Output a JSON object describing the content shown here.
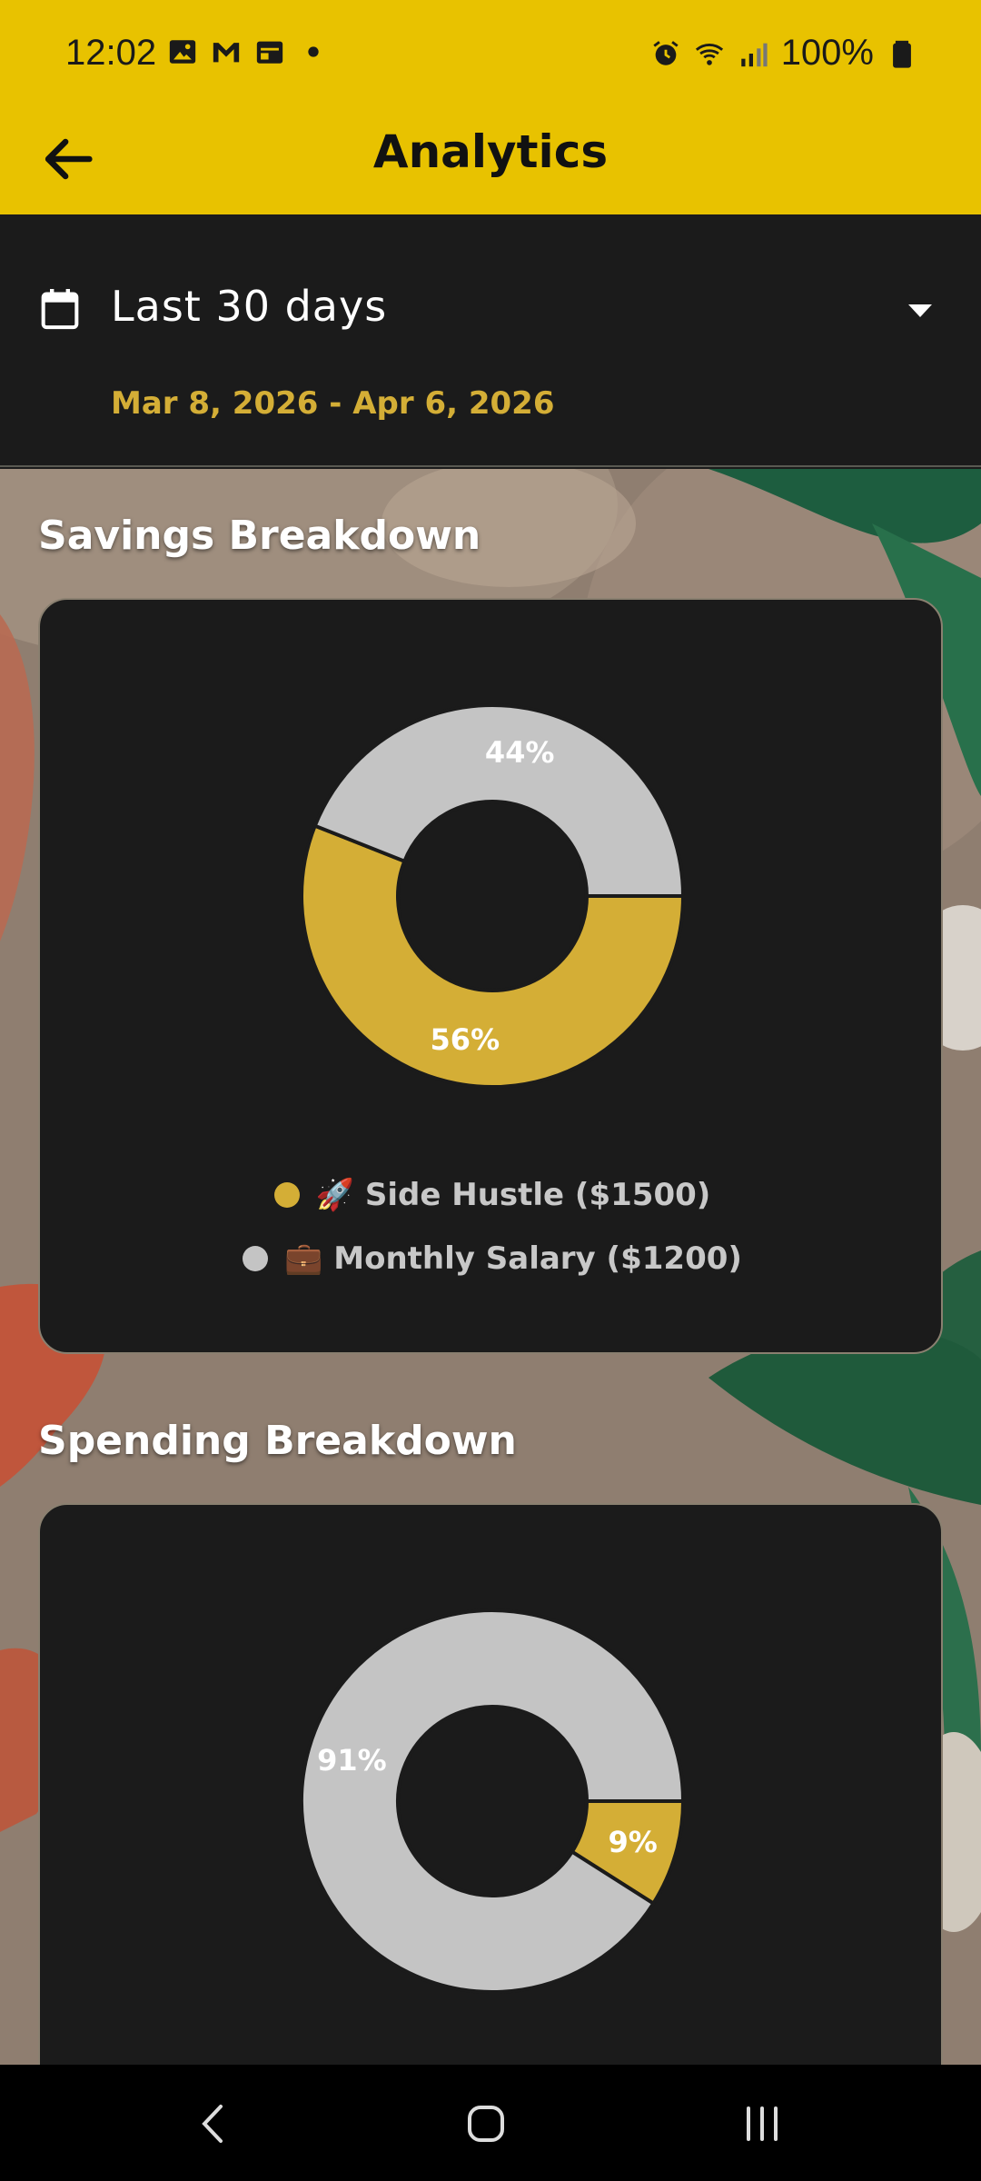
{
  "status_bar": {
    "time": "12:02",
    "battery": "100%"
  },
  "app_bar": {
    "title": "Analytics",
    "back_icon": "arrow-left-icon"
  },
  "date_selector": {
    "range_label": "Last 30 days",
    "range_dates": "Mar 8, 2026 - Apr 6, 2026",
    "calendar_icon": "calendar-icon",
    "dropdown_icon": "caret-down-icon"
  },
  "savings": {
    "title": "Savings Breakdown",
    "legend": [
      {
        "label": "🚀 Side Hustle ($1500)",
        "color": "#d4ae36"
      },
      {
        "label": "💼 Monthly Salary ($1200)",
        "color": "#c4c4c4"
      }
    ]
  },
  "spending": {
    "title": "Spending Breakdown"
  },
  "colors": {
    "accent": "#e8c200",
    "gold": "#d4ae36",
    "grey": "#c4c4c4",
    "card": "#1b1b1b"
  },
  "chart_data": [
    {
      "type": "pie",
      "categories": [
        "🚀 Side Hustle ($1500)",
        "💼 Monthly Salary ($1200)"
      ],
      "values": [
        56,
        44
      ],
      "labels": [
        "56%",
        "44%"
      ],
      "colors": [
        "#d4ae36",
        "#c4c4c4"
      ],
      "start_angle": 0,
      "direction": "clockwise"
    },
    {
      "type": "pie",
      "categories": [
        "gold",
        "grey"
      ],
      "values": [
        9,
        91
      ],
      "labels": [
        "9%",
        "91%"
      ],
      "colors": [
        "#d4ae36",
        "#c4c4c4"
      ],
      "start_angle": 0,
      "direction": "clockwise"
    }
  ]
}
